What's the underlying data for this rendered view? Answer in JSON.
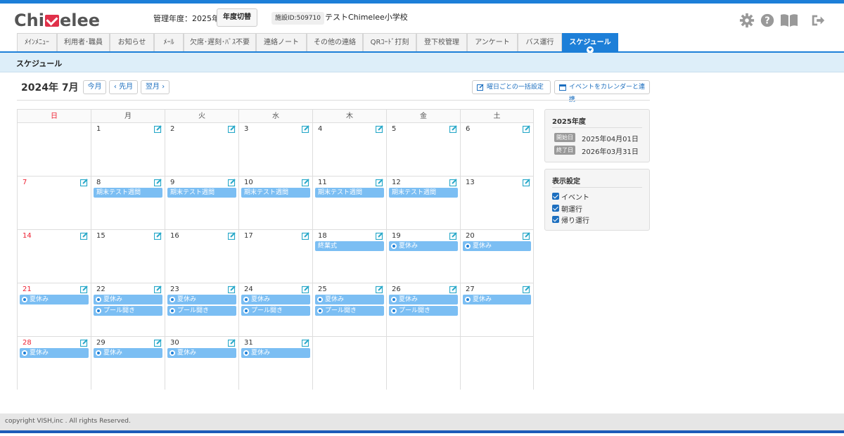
{
  "app": {
    "logo_text_1": "Chi",
    "logo_text_2": "elee",
    "fiscal_year_label": "管理年度：2025年度",
    "fiscal_year_button": "年度切替",
    "facility_id": "施設ID:509710",
    "school_name": "テストChimelee小学校"
  },
  "header_icons": [
    "gear-icon",
    "help-icon",
    "book-icon",
    "logout-icon"
  ],
  "tabs": [
    {
      "label": "ﾒｲﾝﾒﾆｭｰ",
      "active": false
    },
    {
      "label": "利用者･職員",
      "active": false
    },
    {
      "label": "お知らせ",
      "active": false
    },
    {
      "label": "ﾒｰﾙ",
      "active": false
    },
    {
      "label": "欠席･遅刻･ﾊﾞｽ不要",
      "active": false
    },
    {
      "label": "連絡ノート",
      "active": false
    },
    {
      "label": "その他の連絡",
      "active": false
    },
    {
      "label": "QRｺｰﾄﾞ打刻",
      "active": false
    },
    {
      "label": "登下校管理",
      "active": false
    },
    {
      "label": "アンケート",
      "active": false
    },
    {
      "label": "バス運行",
      "active": false
    },
    {
      "label": "スケジュール",
      "active": true
    }
  ],
  "page": {
    "section_title": "スケジュール",
    "month_title": "2024年 7月",
    "btn_today": "今月",
    "btn_prev": "‹ 先月",
    "btn_next": "翌月 ›",
    "btn_bulk": "曜日ごとの一括設定",
    "btn_calendar_link": "イベントをカレンダーと連携"
  },
  "calendar": {
    "weekdays": [
      "日",
      "月",
      "火",
      "水",
      "木",
      "金",
      "土"
    ],
    "weeks": [
      [
        null,
        {
          "d": "1",
          "ev": []
        },
        {
          "d": "2",
          "ev": []
        },
        {
          "d": "3",
          "ev": []
        },
        {
          "d": "4",
          "ev": []
        },
        {
          "d": "5",
          "ev": []
        },
        {
          "d": "6",
          "ev": []
        }
      ],
      [
        {
          "d": "7",
          "ev": []
        },
        {
          "d": "8",
          "ev": [
            "期末テスト週間"
          ]
        },
        {
          "d": "9",
          "ev": [
            "期末テスト週間"
          ]
        },
        {
          "d": "10",
          "ev": [
            "期末テスト週間"
          ]
        },
        {
          "d": "11",
          "ev": [
            "期末テスト週間"
          ]
        },
        {
          "d": "12",
          "ev": [
            "期末テスト週間"
          ]
        },
        {
          "d": "13",
          "ev": []
        }
      ],
      [
        {
          "d": "14",
          "ev": []
        },
        {
          "d": "15",
          "ev": []
        },
        {
          "d": "16",
          "ev": []
        },
        {
          "d": "17",
          "ev": []
        },
        {
          "d": "18",
          "ev": [
            "終業式"
          ]
        },
        {
          "d": "19",
          "ev": [
            "◎夏休み"
          ]
        },
        {
          "d": "20",
          "ev": [
            "◎夏休み"
          ]
        }
      ],
      [
        {
          "d": "21",
          "ev": [
            "◎夏休み"
          ]
        },
        {
          "d": "22",
          "ev": [
            "◎夏休み",
            "◎プール開き"
          ]
        },
        {
          "d": "23",
          "ev": [
            "◎夏休み",
            "◎プール開き"
          ]
        },
        {
          "d": "24",
          "ev": [
            "◎夏休み",
            "◎プール開き"
          ]
        },
        {
          "d": "25",
          "ev": [
            "◎夏休み",
            "◎プール開き"
          ]
        },
        {
          "d": "26",
          "ev": [
            "◎夏休み",
            "◎プール開き"
          ]
        },
        {
          "d": "27",
          "ev": [
            "◎夏休み"
          ]
        }
      ],
      [
        {
          "d": "28",
          "ev": [
            "◎夏休み"
          ]
        },
        {
          "d": "29",
          "ev": [
            "◎夏休み"
          ]
        },
        {
          "d": "30",
          "ev": [
            "◎夏休み"
          ]
        },
        {
          "d": "31",
          "ev": [
            "◎夏休み"
          ]
        },
        null,
        null,
        null
      ]
    ]
  },
  "year_panel": {
    "title": "2025年度",
    "start_label": "開始日",
    "start_value": "2025年04月01日",
    "end_label": "終了日",
    "end_value": "2026年03月31日"
  },
  "display_panel": {
    "title": "表示設定",
    "options": [
      {
        "label": "イベント",
        "checked": true
      },
      {
        "label": "朝運行",
        "checked": true
      },
      {
        "label": "帰り運行",
        "checked": true
      }
    ]
  },
  "footer": {
    "copyright": "copyright VISH,inc . All rights Reserved."
  },
  "colors": {
    "accent": "#1d7fd8",
    "event": "#7bbef3",
    "sunday": "#e22233"
  }
}
